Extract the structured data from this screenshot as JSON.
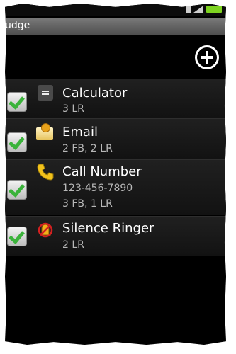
{
  "app": {
    "title": "udge"
  },
  "toolbar": {
    "add_icon": "plus-circle-icon"
  },
  "colors": {
    "check": "#3bb33b",
    "background": "#000000",
    "subtitle": "#b8b8b8"
  },
  "items": [
    {
      "title": "Calculator",
      "detail": "3 LR",
      "icon": "calculator-icon",
      "checked": true
    },
    {
      "title": "Email",
      "detail": "2 FB, 2 LR",
      "icon": "email-icon",
      "checked": true
    },
    {
      "title": "Call Number",
      "number": "123-456-7890",
      "detail": "3 FB, 1 LR",
      "icon": "phone-icon",
      "checked": true
    },
    {
      "title": "Silence Ringer",
      "detail": "2 LR",
      "icon": "silence-ringer-icon",
      "checked": true
    }
  ]
}
